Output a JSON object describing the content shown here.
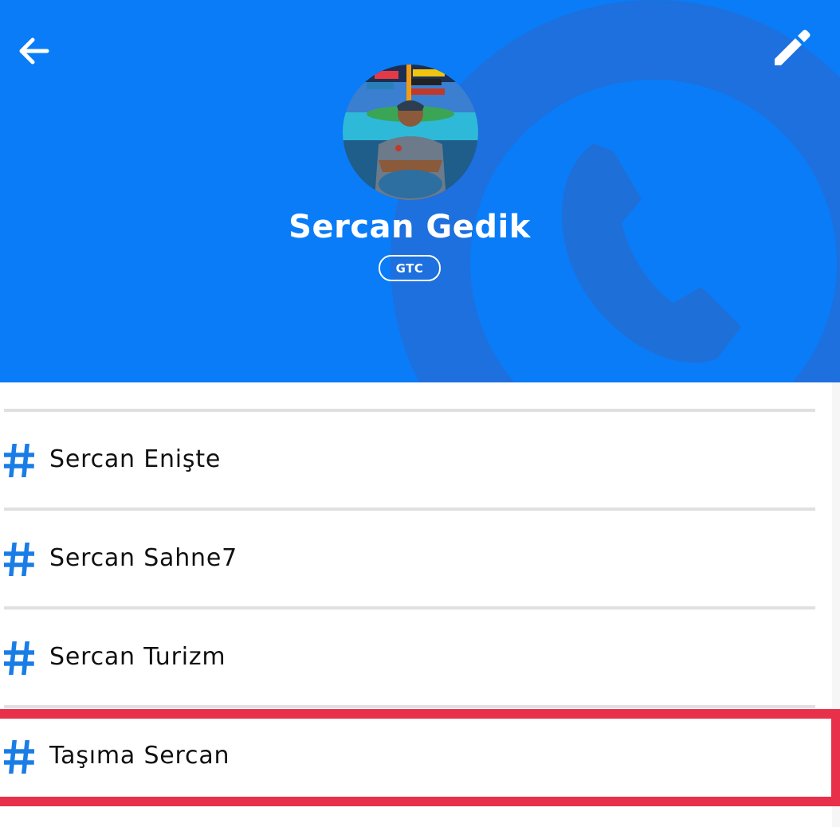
{
  "header": {
    "background_color": "#0a7cf7",
    "back_icon": "arrow-left-icon",
    "edit_icon": "pencil-icon",
    "watermark_icon": "phone-icon"
  },
  "profile": {
    "name": "Sercan Gedik",
    "badge": "GTC"
  },
  "list": {
    "items": [
      {
        "icon": "hash-icon",
        "label": "Sercan Enişte"
      },
      {
        "icon": "hash-icon",
        "label": "Sercan Sahne7"
      },
      {
        "icon": "hash-icon",
        "label": "Sercan Turizm"
      },
      {
        "icon": "hash-icon",
        "label": "Taşıma Sercan",
        "highlighted": true
      }
    ]
  },
  "colors": {
    "accent": "#0a7cf7",
    "hash": "#1a7de6",
    "highlight": "#e8304a",
    "divider": "#e0e0e0"
  }
}
